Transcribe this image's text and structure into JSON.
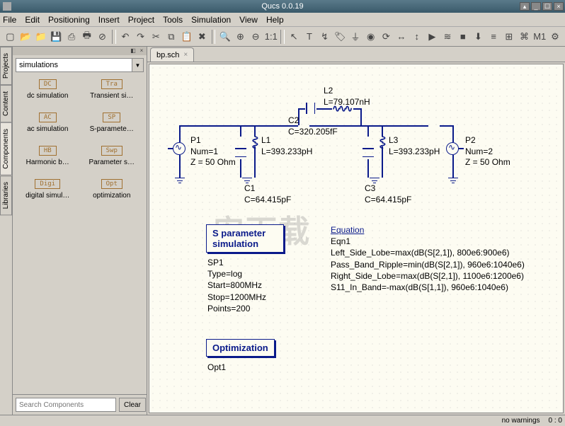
{
  "title": "Qucs 0.0.19",
  "menu": [
    "File",
    "Edit",
    "Positioning",
    "Insert",
    "Project",
    "Tools",
    "Simulation",
    "View",
    "Help"
  ],
  "toolbar_icons": [
    "new",
    "open",
    "open2",
    "save",
    "saveall",
    "print",
    "close",
    "",
    "undo",
    "redo",
    "cut",
    "copy",
    "paste",
    "delete",
    "",
    "zoomfit",
    "zoomin",
    "zoomout",
    "zoom1",
    "",
    "cursor",
    "text",
    "wire",
    "label",
    "ground",
    "port",
    "rotate",
    "mirrorx",
    "mirrory",
    "sim",
    "dcbias",
    "stop",
    "setmarker",
    "align",
    "dist",
    "ontext",
    "m1",
    "m2"
  ],
  "side_tabs": [
    "Projects",
    "Content",
    "Components",
    "Libraries"
  ],
  "combo": "simulations",
  "sim_items": [
    {
      "box": "DC",
      "label": "dc simulation"
    },
    {
      "box": "Tra",
      "label": "Transient si…"
    },
    {
      "box": "AC",
      "label": "ac simulation"
    },
    {
      "box": "SP",
      "label": "S-paramete…"
    },
    {
      "box": "HB",
      "label": "Harmonic b…"
    },
    {
      "box": "Swp",
      "label": "Parameter s…"
    },
    {
      "box": "Digi",
      "label": "digital simul…"
    },
    {
      "box": "Opt",
      "label": "optimization"
    }
  ],
  "search_placeholder": "Search Components",
  "clear": "Clear",
  "filetab": "bp.sch",
  "schematic": {
    "P1": {
      "name": "P1",
      "num": "Num=1",
      "z": "Z = 50 Ohm"
    },
    "P2": {
      "name": "P2",
      "num": "Num=2",
      "z": "Z = 50 Ohm"
    },
    "L1": {
      "name": "L1",
      "val": "L=393.233pH"
    },
    "L2": {
      "name": "L2",
      "val": "L=79.107nH"
    },
    "L3": {
      "name": "L3",
      "val": "L=393.233pH"
    },
    "C1": {
      "name": "C1",
      "val": "C=64.415pF"
    },
    "C2": {
      "name": "C2",
      "val": "C=320.205fF"
    },
    "C3": {
      "name": "C3",
      "val": "C=64.415pF"
    },
    "sparam": {
      "title1": "S parameter",
      "title2": "simulation",
      "name": "SP1",
      "type": "Type=log",
      "start": "Start=800MHz",
      "stop": "Stop=1200MHz",
      "points": "Points=200"
    },
    "opt": {
      "title": "Optimization",
      "name": "Opt1"
    },
    "eqn": {
      "hdr": "Equation",
      "name": "Eqn1",
      "l1": "Left_Side_Lobe=max(dB(S[2,1]), 800e6:900e6)",
      "l2": "Pass_Band_Ripple=min(dB(S[2,1]), 960e6:1040e6)",
      "l3": "Right_Side_Lobe=max(dB(S[2,1]), 1100e6:1200e6)",
      "l4": "S11_In_Band=-max(dB(S[1,1]), 960e6:1040e6)"
    }
  },
  "status": {
    "warnings": "no warnings",
    "pos": "0 : 0"
  }
}
